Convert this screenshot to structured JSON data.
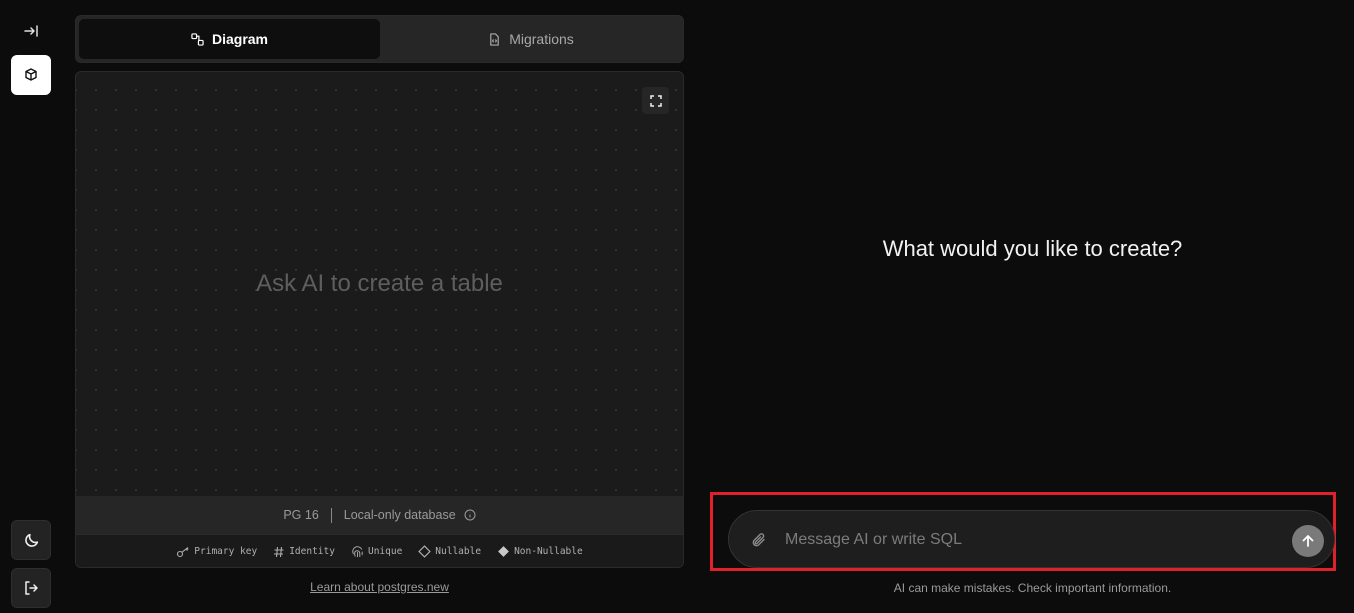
{
  "rail": {
    "icons": [
      "collapse-sidebar-icon",
      "database-icon",
      "moon-icon",
      "logout-icon"
    ]
  },
  "tabs": [
    {
      "label": "Diagram",
      "icon": "diagram-icon",
      "active": true
    },
    {
      "label": "Migrations",
      "icon": "file-code-icon",
      "active": false
    }
  ],
  "canvas": {
    "empty_message": "Ask AI to create a table",
    "status": {
      "version": "PG 16",
      "db_label": "Local-only database"
    },
    "legend": [
      {
        "icon": "key-icon",
        "label": "Primary key"
      },
      {
        "icon": "hash-icon",
        "label": "Identity"
      },
      {
        "icon": "fingerprint-icon",
        "label": "Unique"
      },
      {
        "icon": "diamond-outline-icon",
        "label": "Nullable"
      },
      {
        "icon": "diamond-filled-icon",
        "label": "Non-Nullable"
      }
    ]
  },
  "learn_link": "Learn about postgres.new",
  "chat": {
    "headline": "What would you like to create?",
    "placeholder": "Message AI or write SQL",
    "disclaimer": "AI can make mistakes. Check important information."
  },
  "colors": {
    "highlight": "#e0202a",
    "background": "#0c0c0c"
  }
}
